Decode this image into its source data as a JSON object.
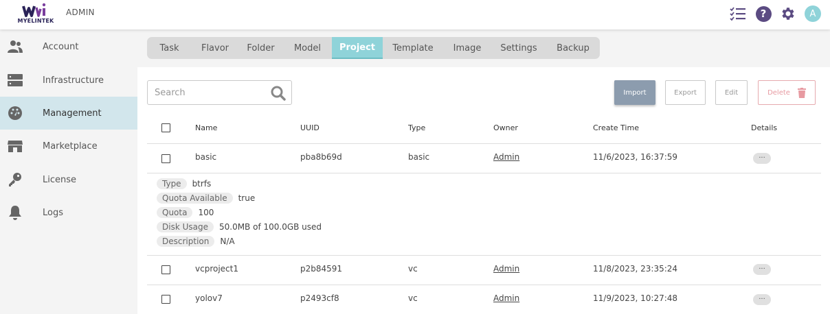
{
  "header": {
    "logo_text": "MYELINTEK",
    "admin_label": "ADMIN",
    "avatar_initial": "A",
    "help_glyph": "?",
    "icons": [
      "tasks-icon",
      "help-icon",
      "settings-icon",
      "avatar"
    ],
    "colors": {
      "brand": "#2a2358",
      "accent": "#8fd3d9",
      "help": "#5b4b82"
    }
  },
  "sidebar": {
    "items": [
      {
        "label": "Account",
        "icon": "account-icon"
      },
      {
        "label": "Infrastructure",
        "icon": "server-icon"
      },
      {
        "label": "Management",
        "icon": "dashboard-icon",
        "active": true
      },
      {
        "label": "Marketplace",
        "icon": "store-icon"
      },
      {
        "label": "License",
        "icon": "key-icon"
      },
      {
        "label": "Logs",
        "icon": "bell-icon"
      }
    ]
  },
  "tabs": [
    {
      "label": "Task"
    },
    {
      "label": "Flavor"
    },
    {
      "label": "Folder"
    },
    {
      "label": "Model"
    },
    {
      "label": "Project",
      "active": true
    },
    {
      "label": "Template"
    },
    {
      "label": "Image"
    },
    {
      "label": "Settings"
    },
    {
      "label": "Backup"
    }
  ],
  "toolbar": {
    "search_placeholder": "Search",
    "import_label": "Import",
    "export_label": "Export",
    "edit_label": "Edit",
    "delete_label": "Delete"
  },
  "table": {
    "headers": {
      "name": "Name",
      "uuid": "UUID",
      "type": "Type",
      "owner": "Owner",
      "create_time": "Create Time",
      "details": "Details"
    },
    "rows": [
      {
        "name": "basic",
        "uuid": "pba8b69d",
        "type": "basic",
        "owner": "Admin",
        "create_time": "11/6/2023, 16:37:59",
        "details": "···"
      },
      {
        "name": "vcproject1",
        "uuid": "p2b84591",
        "type": "vc",
        "owner": "Admin",
        "create_time": "11/8/2023, 23:35:24",
        "details": "···"
      },
      {
        "name": "yolov7",
        "uuid": "p2493cf8",
        "type": "vc",
        "owner": "Admin",
        "create_time": "11/9/2023, 10:27:48",
        "details": "···"
      }
    ],
    "expanded_details": [
      {
        "label": "Type",
        "value": "btrfs"
      },
      {
        "label": "Quota Available",
        "value": "true"
      },
      {
        "label": "Quota",
        "value": "100"
      },
      {
        "label": "Disk Usage",
        "value": "50.0MB of 100.0GB used"
      },
      {
        "label": "Description",
        "value": "N/A"
      }
    ]
  }
}
